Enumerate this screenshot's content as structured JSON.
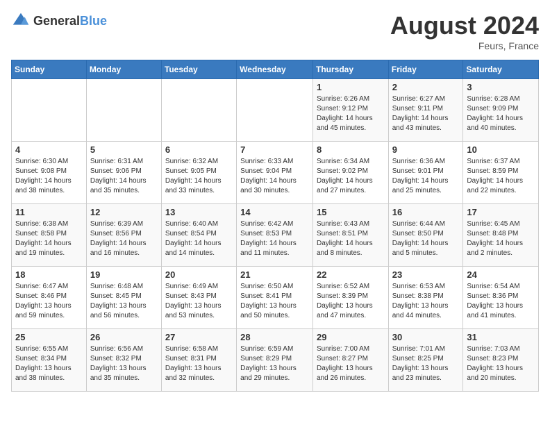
{
  "header": {
    "logo_general": "General",
    "logo_blue": "Blue",
    "month_year": "August 2024",
    "location": "Feurs, France"
  },
  "weekdays": [
    "Sunday",
    "Monday",
    "Tuesday",
    "Wednesday",
    "Thursday",
    "Friday",
    "Saturday"
  ],
  "weeks": [
    [
      {
        "day": "",
        "info": ""
      },
      {
        "day": "",
        "info": ""
      },
      {
        "day": "",
        "info": ""
      },
      {
        "day": "",
        "info": ""
      },
      {
        "day": "1",
        "info": "Sunrise: 6:26 AM\nSunset: 9:12 PM\nDaylight: 14 hours and 45 minutes."
      },
      {
        "day": "2",
        "info": "Sunrise: 6:27 AM\nSunset: 9:11 PM\nDaylight: 14 hours and 43 minutes."
      },
      {
        "day": "3",
        "info": "Sunrise: 6:28 AM\nSunset: 9:09 PM\nDaylight: 14 hours and 40 minutes."
      }
    ],
    [
      {
        "day": "4",
        "info": "Sunrise: 6:30 AM\nSunset: 9:08 PM\nDaylight: 14 hours and 38 minutes."
      },
      {
        "day": "5",
        "info": "Sunrise: 6:31 AM\nSunset: 9:06 PM\nDaylight: 14 hours and 35 minutes."
      },
      {
        "day": "6",
        "info": "Sunrise: 6:32 AM\nSunset: 9:05 PM\nDaylight: 14 hours and 33 minutes."
      },
      {
        "day": "7",
        "info": "Sunrise: 6:33 AM\nSunset: 9:04 PM\nDaylight: 14 hours and 30 minutes."
      },
      {
        "day": "8",
        "info": "Sunrise: 6:34 AM\nSunset: 9:02 PM\nDaylight: 14 hours and 27 minutes."
      },
      {
        "day": "9",
        "info": "Sunrise: 6:36 AM\nSunset: 9:01 PM\nDaylight: 14 hours and 25 minutes."
      },
      {
        "day": "10",
        "info": "Sunrise: 6:37 AM\nSunset: 8:59 PM\nDaylight: 14 hours and 22 minutes."
      }
    ],
    [
      {
        "day": "11",
        "info": "Sunrise: 6:38 AM\nSunset: 8:58 PM\nDaylight: 14 hours and 19 minutes."
      },
      {
        "day": "12",
        "info": "Sunrise: 6:39 AM\nSunset: 8:56 PM\nDaylight: 14 hours and 16 minutes."
      },
      {
        "day": "13",
        "info": "Sunrise: 6:40 AM\nSunset: 8:54 PM\nDaylight: 14 hours and 14 minutes."
      },
      {
        "day": "14",
        "info": "Sunrise: 6:42 AM\nSunset: 8:53 PM\nDaylight: 14 hours and 11 minutes."
      },
      {
        "day": "15",
        "info": "Sunrise: 6:43 AM\nSunset: 8:51 PM\nDaylight: 14 hours and 8 minutes."
      },
      {
        "day": "16",
        "info": "Sunrise: 6:44 AM\nSunset: 8:50 PM\nDaylight: 14 hours and 5 minutes."
      },
      {
        "day": "17",
        "info": "Sunrise: 6:45 AM\nSunset: 8:48 PM\nDaylight: 14 hours and 2 minutes."
      }
    ],
    [
      {
        "day": "18",
        "info": "Sunrise: 6:47 AM\nSunset: 8:46 PM\nDaylight: 13 hours and 59 minutes."
      },
      {
        "day": "19",
        "info": "Sunrise: 6:48 AM\nSunset: 8:45 PM\nDaylight: 13 hours and 56 minutes."
      },
      {
        "day": "20",
        "info": "Sunrise: 6:49 AM\nSunset: 8:43 PM\nDaylight: 13 hours and 53 minutes."
      },
      {
        "day": "21",
        "info": "Sunrise: 6:50 AM\nSunset: 8:41 PM\nDaylight: 13 hours and 50 minutes."
      },
      {
        "day": "22",
        "info": "Sunrise: 6:52 AM\nSunset: 8:39 PM\nDaylight: 13 hours and 47 minutes."
      },
      {
        "day": "23",
        "info": "Sunrise: 6:53 AM\nSunset: 8:38 PM\nDaylight: 13 hours and 44 minutes."
      },
      {
        "day": "24",
        "info": "Sunrise: 6:54 AM\nSunset: 8:36 PM\nDaylight: 13 hours and 41 minutes."
      }
    ],
    [
      {
        "day": "25",
        "info": "Sunrise: 6:55 AM\nSunset: 8:34 PM\nDaylight: 13 hours and 38 minutes."
      },
      {
        "day": "26",
        "info": "Sunrise: 6:56 AM\nSunset: 8:32 PM\nDaylight: 13 hours and 35 minutes."
      },
      {
        "day": "27",
        "info": "Sunrise: 6:58 AM\nSunset: 8:31 PM\nDaylight: 13 hours and 32 minutes."
      },
      {
        "day": "28",
        "info": "Sunrise: 6:59 AM\nSunset: 8:29 PM\nDaylight: 13 hours and 29 minutes."
      },
      {
        "day": "29",
        "info": "Sunrise: 7:00 AM\nSunset: 8:27 PM\nDaylight: 13 hours and 26 minutes."
      },
      {
        "day": "30",
        "info": "Sunrise: 7:01 AM\nSunset: 8:25 PM\nDaylight: 13 hours and 23 minutes."
      },
      {
        "day": "31",
        "info": "Sunrise: 7:03 AM\nSunset: 8:23 PM\nDaylight: 13 hours and 20 minutes."
      }
    ]
  ]
}
